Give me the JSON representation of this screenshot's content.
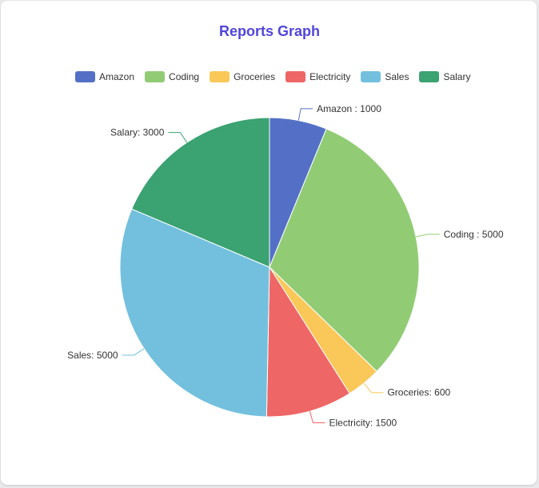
{
  "title": "Reports Graph",
  "chart_data": {
    "type": "pie",
    "title": "Reports Graph",
    "legend_position": "top",
    "slices": [
      {
        "name": "Amazon",
        "value": 1000,
        "color": "#5470c6",
        "label": "Amazon : 1000"
      },
      {
        "name": "Coding",
        "value": 5000,
        "color": "#91cc75",
        "label": "Coding : 5000"
      },
      {
        "name": "Groceries",
        "value": 600,
        "color": "#fac858",
        "label": "Groceries: 600"
      },
      {
        "name": "Electricity",
        "value": 1500,
        "color": "#ee6666",
        "label": "Electricity: 1500"
      },
      {
        "name": "Sales",
        "value": 5000,
        "color": "#73c0de",
        "label": "Sales: 5000"
      },
      {
        "name": "Salary",
        "value": 3000,
        "color": "#3ba272",
        "label": "Salary: 3000"
      }
    ]
  }
}
